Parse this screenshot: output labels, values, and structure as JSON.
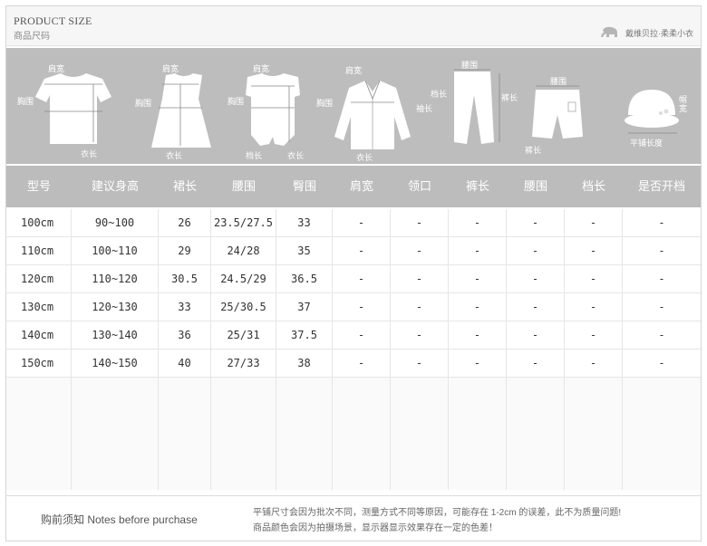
{
  "header": {
    "title_en": "PRODUCT SIZE",
    "title_cn": "商品尺码",
    "brand": "戴维贝拉·柔柔小衣"
  },
  "illustrations": {
    "labels": {
      "shoulder": "肩宽",
      "bust": "胸围",
      "length": "衣长",
      "waist": "腰围",
      "sleeve": "袖长",
      "pants_length": "裤长",
      "crotch": "档长",
      "hat": "帽宽",
      "hat_flat": "平铺长度"
    }
  },
  "table": {
    "headers": [
      "型号",
      "建议身高",
      "裙长",
      "腰围",
      "臀围",
      "肩宽",
      "领口",
      "裤长",
      "腰围",
      "档长",
      "是否开档"
    ],
    "rows": [
      [
        "100cm",
        "90~100",
        "26",
        "23.5/27.5",
        "33",
        "-",
        "-",
        "-",
        "-",
        "-",
        "-"
      ],
      [
        "110cm",
        "100~110",
        "29",
        "24/28",
        "35",
        "-",
        "-",
        "-",
        "-",
        "-",
        "-"
      ],
      [
        "120cm",
        "110~120",
        "30.5",
        "24.5/29",
        "36.5",
        "-",
        "-",
        "-",
        "-",
        "-",
        "-"
      ],
      [
        "130cm",
        "120~130",
        "33",
        "25/30.5",
        "37",
        "-",
        "-",
        "-",
        "-",
        "-",
        "-"
      ],
      [
        "140cm",
        "130~140",
        "36",
        "25/31",
        "37.5",
        "-",
        "-",
        "-",
        "-",
        "-",
        "-"
      ],
      [
        "150cm",
        "140~150",
        "40",
        "27/33",
        "38",
        "-",
        "-",
        "-",
        "-",
        "-",
        "-"
      ]
    ]
  },
  "footer": {
    "title": "购前须知 Notes before purchase",
    "note1": "平铺尺寸会因为批次不同，测量方式不同等原因，可能存在 1-2cm 的误差，此不为质量问题!",
    "note2": "商品颜色会因为拍摄场景，显示器显示效果存在一定的色差！"
  }
}
